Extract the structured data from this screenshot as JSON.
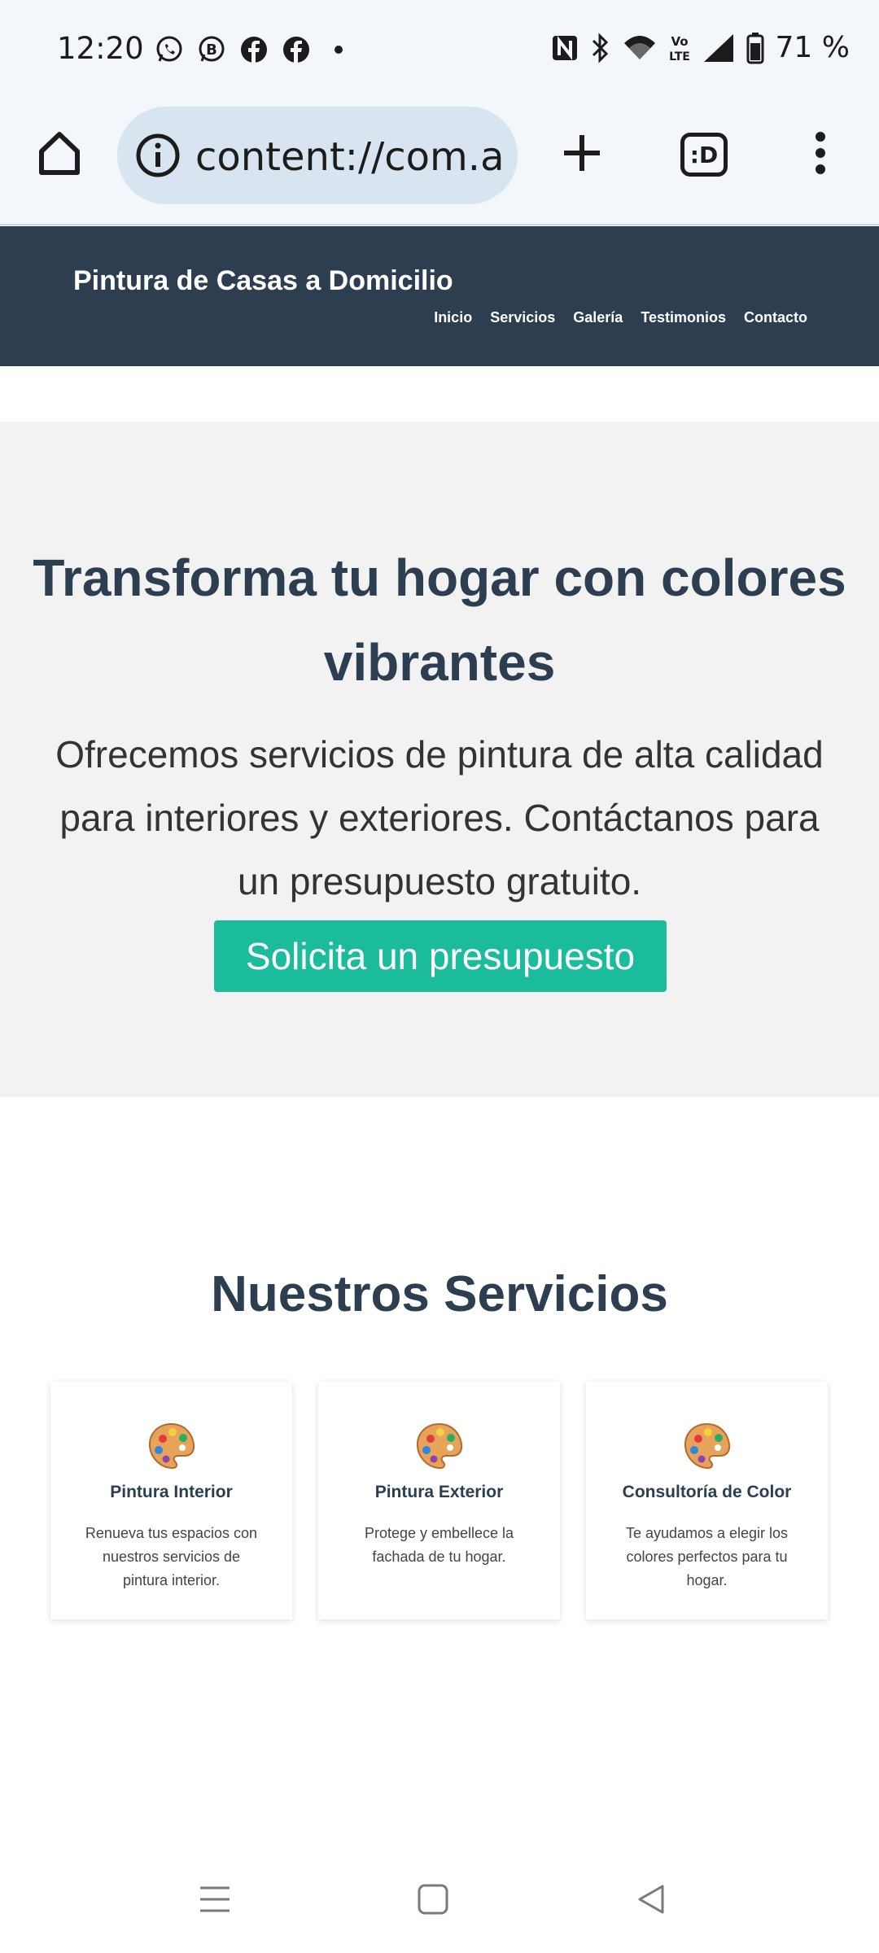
{
  "status_bar": {
    "time": "12:20",
    "battery": "71 %",
    "notification_icons": [
      "whatsapp-icon",
      "whatsapp-business-icon",
      "facebook-icon",
      "facebook-icon",
      "dot-icon"
    ],
    "system_icons": [
      "nfc-icon",
      "bluetooth-icon",
      "wifi-icon",
      "volte-icon",
      "signal-icon",
      "battery-icon"
    ]
  },
  "browser": {
    "url": "content://com.acer",
    "tabs_label": ":D"
  },
  "site_header": {
    "logo": "Pintura de Casas a Domicilio",
    "nav": [
      "Inicio",
      "Servicios",
      "Galería",
      "Testimonios",
      "Contacto"
    ],
    "background_color": "#2c3e50"
  },
  "hero": {
    "title": "Transforma tu hogar con colores vibrantes",
    "subtitle": "Ofrecemos servicios de pintura de alta calidad para interiores y exteriores. Contáctanos para un presupuesto gratuito.",
    "cta_label": "Solicita un presupuesto",
    "cta_color": "#1abc9c"
  },
  "services": {
    "title": "Nuestros Servicios",
    "items": [
      {
        "icon": "palette-icon",
        "title": "Pintura Interior",
        "description": "Renueva tus espacios con nuestros servicios de pintura interior."
      },
      {
        "icon": "palette-icon",
        "title": "Pintura Exterior",
        "description": "Protege y embellece la fachada de tu hogar."
      },
      {
        "icon": "palette-icon",
        "title": "Consultoría de Color",
        "description": "Te ayudamos a elegir los colores perfectos para tu hogar."
      }
    ]
  },
  "nav_bar": {
    "buttons": [
      "recents-icon",
      "home-icon",
      "back-icon"
    ]
  }
}
